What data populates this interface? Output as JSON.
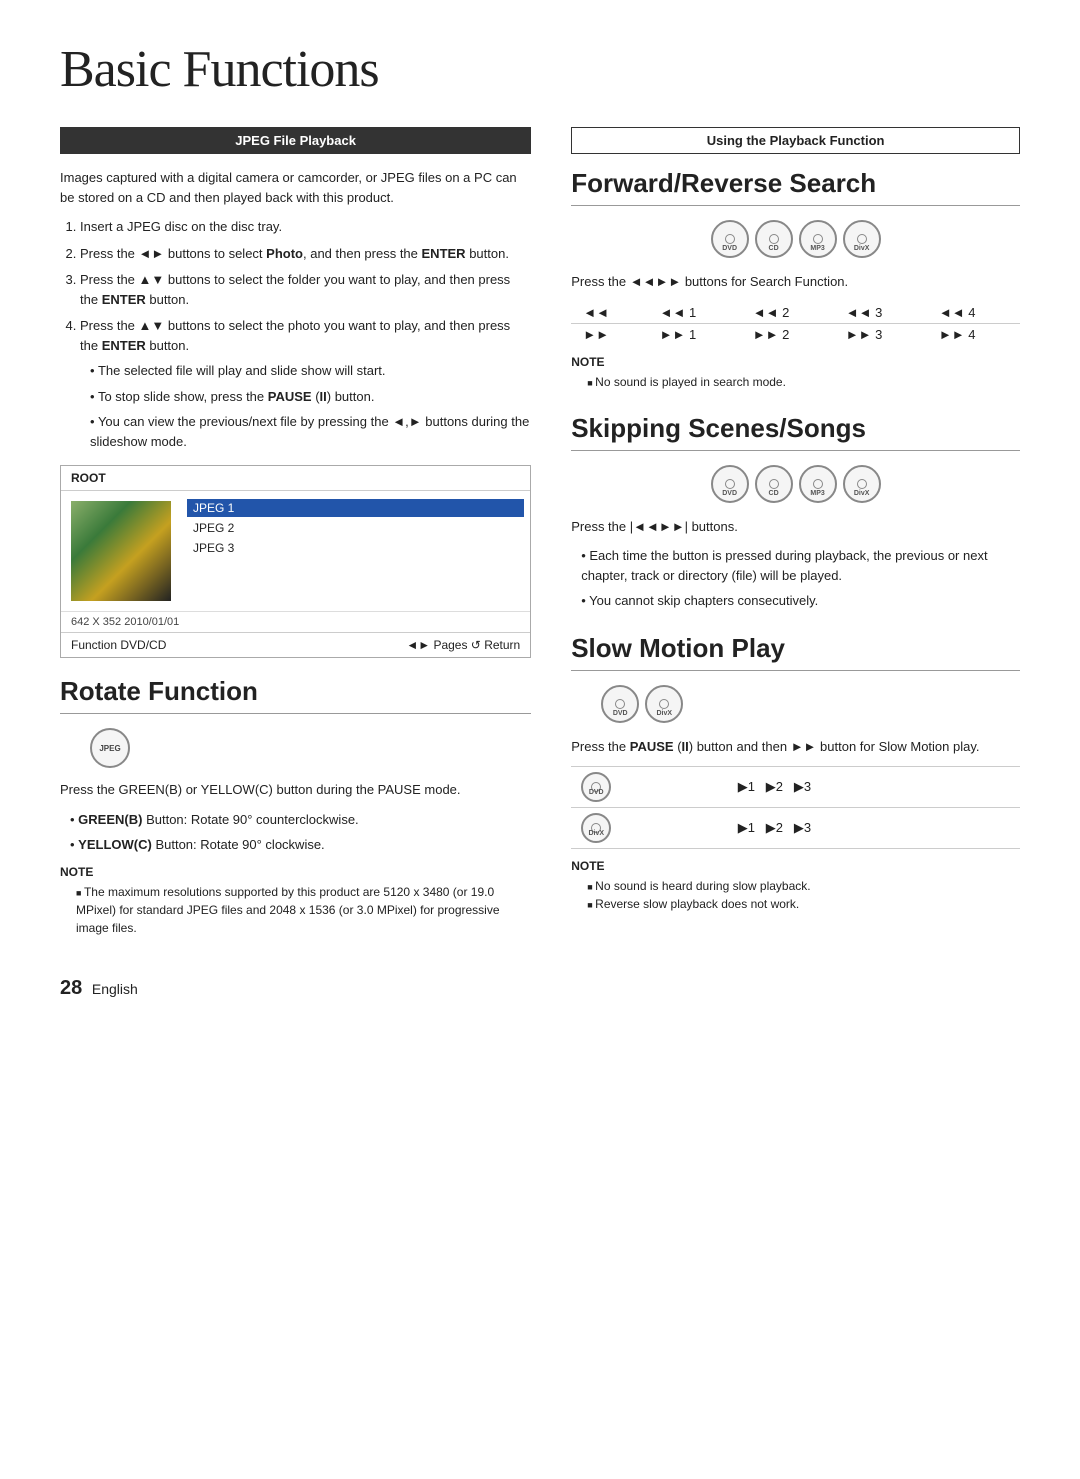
{
  "page": {
    "title": "Basic Functions",
    "page_number": "28",
    "page_label": "English"
  },
  "left_col": {
    "jpeg_header": "JPEG File Playback",
    "jpeg_intro": "Images captured with a digital camera or camcorder, or JPEG files on a PC can be stored on a CD and then played back with this product.",
    "steps": [
      {
        "num": 1,
        "text": "Insert a JPEG disc on the disc tray."
      },
      {
        "num": 2,
        "text": "Press the ◄► buttons to select Photo, and then press the ENTER button."
      },
      {
        "num": 3,
        "text": "Press the ▲▼ buttons to select the folder you want to play, and then press the ENTER button."
      },
      {
        "num": 4,
        "text": "Press the ▲▼ buttons to select the photo you want to play, and then press the ENTER button."
      }
    ],
    "sub_bullets": [
      "The selected file will play and slide show will start.",
      "To stop slide show, press the PAUSE (II) button.",
      "You can view the previous/next file by pressing the ◄,► buttons during the slideshow mode."
    ],
    "file_browser": {
      "header": "ROOT",
      "items": [
        "JPEG 1",
        "JPEG 2",
        "JPEG 3"
      ],
      "selected_index": 0,
      "info": "642 X 352   2010/01/01",
      "footer_left": "Function  DVD/CD",
      "footer_right": "◄► Pages  ↺ Return"
    },
    "rotate_section": {
      "title": "Rotate Function",
      "badge_label": "JPEG",
      "description": "Press the GREEN(B) or YELLOW(C) button during the PAUSE mode.",
      "bullets": [
        "GREEN(B) Button: Rotate 90° counterclockwise.",
        "YELLOW(C) Button: Rotate 90° clockwise."
      ],
      "note_label": "NOTE",
      "note_items": [
        "The maximum resolutions supported by this product are 5120 x 3480 (or 19.0 MPixel) for standard JPEG files and 2048 x 1536 (or 3.0 MPixel) for progressive image files."
      ]
    }
  },
  "right_col": {
    "playback_header": "Using the Playback Function",
    "forward_reverse": {
      "title": "Forward/Reverse Search",
      "badges": [
        "DVD",
        "CD",
        "MP3",
        "DivX"
      ],
      "description": "Press the ◄◄►► buttons for Search Function.",
      "speeds_row1": [
        "◄◄",
        "◄◄ 1",
        "◄◄ 2",
        "◄◄ 3",
        "◄◄ 4"
      ],
      "speeds_row2": [
        "►►",
        "►► 1",
        "►► 2",
        "►► 3",
        "►► 4"
      ],
      "note_label": "NOTE",
      "note_items": [
        "No sound is played in search mode."
      ]
    },
    "skipping": {
      "title": "Skipping Scenes/Songs",
      "badges": [
        "DVD",
        "CD",
        "MP3",
        "DivX"
      ],
      "description": "Press the |◄◄►►| buttons.",
      "bullets": [
        "Each time the button is pressed during playback, the previous or next chapter, track or directory (file) will be played.",
        "You cannot skip chapters consecutively."
      ]
    },
    "slow_motion": {
      "title": "Slow Motion Play",
      "badges": [
        "DVD",
        "DivX"
      ],
      "description": "Press the PAUSE (II) button and then ►► button for Slow Motion play.",
      "rows": [
        {
          "badge": "DVD",
          "speeds": "▶1   ▶2   ▶3"
        },
        {
          "badge": "DivX",
          "speeds": "▶1   ▶2   ▶3"
        }
      ],
      "note_label": "NOTE",
      "note_items": [
        "No sound is heard during slow playback.",
        "Reverse slow playback does not work."
      ]
    }
  }
}
